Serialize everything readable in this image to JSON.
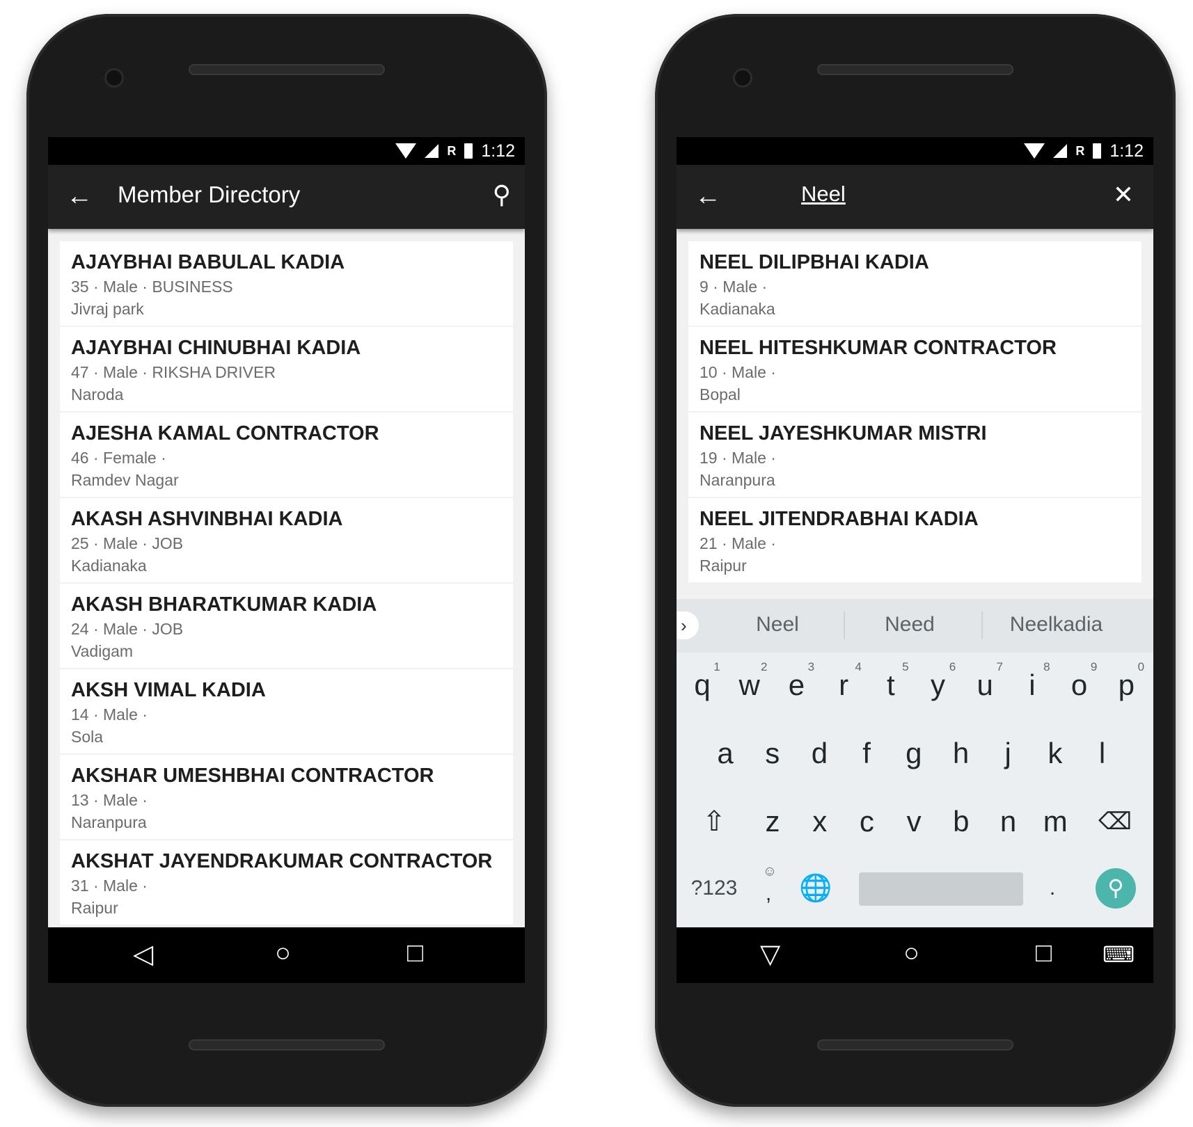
{
  "status": {
    "time": "1:12",
    "carrier": "R"
  },
  "left": {
    "title": "Member Directory",
    "members": [
      {
        "name": "AJAYBHAI BABULAL KADIA",
        "meta": "35 · Male · BUSINESS",
        "place": "Jivraj park"
      },
      {
        "name": "AJAYBHAI CHINUBHAI KADIA",
        "meta": "47 · Male · RIKSHA DRIVER",
        "place": "Naroda"
      },
      {
        "name": "AJESHA KAMAL CONTRACTOR",
        "meta": "46 · Female ·",
        "place": "Ramdev Nagar"
      },
      {
        "name": "AKASH ASHVINBHAI KADIA",
        "meta": "25 · Male · JOB",
        "place": "Kadianaka"
      },
      {
        "name": "AKASH BHARATKUMAR KADIA",
        "meta": "24 · Male · JOB",
        "place": "Vadigam"
      },
      {
        "name": "AKSH VIMAL KADIA",
        "meta": "14 · Male ·",
        "place": "Sola"
      },
      {
        "name": "AKSHAR UMESHBHAI CONTRACTOR",
        "meta": "13 · Male ·",
        "place": "Naranpura"
      },
      {
        "name": "AKSHAT JAYENDRAKUMAR CONTRACTOR",
        "meta": "31 · Male ·",
        "place": "Raipur"
      }
    ]
  },
  "right": {
    "search_query": "Neel",
    "members": [
      {
        "name": "NEEL DILIPBHAI KADIA",
        "meta": "9 · Male ·",
        "place": "Kadianaka"
      },
      {
        "name": "NEEL HITESHKUMAR CONTRACTOR",
        "meta": "10 · Male ·",
        "place": "Bopal"
      },
      {
        "name": "NEEL JAYESHKUMAR MISTRI",
        "meta": "19 · Male ·",
        "place": "Naranpura"
      },
      {
        "name": "NEEL JITENDRABHAI KADIA",
        "meta": "21 · Male ·",
        "place": "Raipur"
      }
    ],
    "keyboard": {
      "suggestions": [
        "Neel",
        "Need",
        "Neelkadia"
      ],
      "row1": [
        "q",
        "w",
        "e",
        "r",
        "t",
        "y",
        "u",
        "i",
        "o",
        "p"
      ],
      "row1_hints": [
        "1",
        "2",
        "3",
        "4",
        "5",
        "6",
        "7",
        "8",
        "9",
        "0"
      ],
      "row2": [
        "a",
        "s",
        "d",
        "f",
        "g",
        "h",
        "j",
        "k",
        "l"
      ],
      "row3": [
        "z",
        "x",
        "c",
        "v",
        "b",
        "n",
        "m"
      ],
      "symbols_label": "?123",
      "comma": ",",
      "period": ".",
      "accent": "#4db6ac"
    }
  }
}
